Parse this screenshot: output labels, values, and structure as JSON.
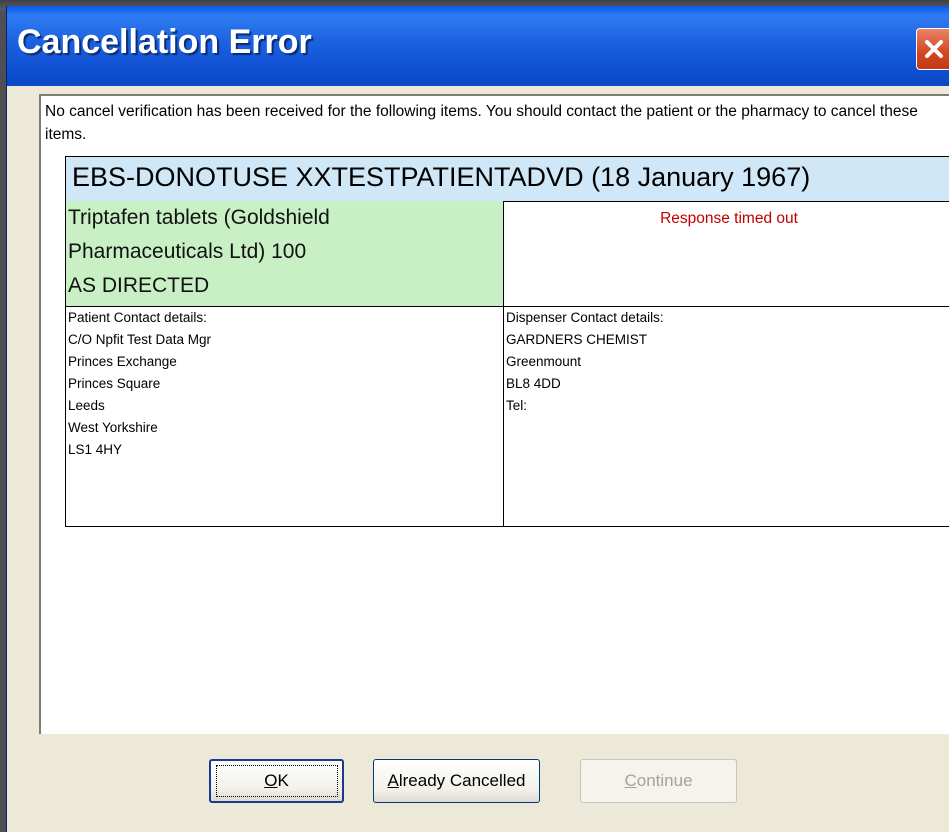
{
  "window": {
    "title": "Cancellation Error",
    "close_icon": "close-x-icon"
  },
  "message": "No cancel verification has been received for the following items. You should contact the patient or the pharmacy to cancel these items.",
  "patient": {
    "header": "EBS-DONOTUSE XXTESTPATIENTADVD (18 January 1967)"
  },
  "item": {
    "drug_lines": [
      "Triptafen tablets (Goldshield",
      "Pharmaceuticals Ltd) 100",
      "AS DIRECTED"
    ],
    "status": "Response timed out"
  },
  "patient_contact": {
    "lines": [
      "Patient Contact details:",
      "C/O Npfit Test Data Mgr",
      "Princes Exchange",
      "Princes Square",
      "Leeds",
      "West Yorkshire",
      "LS1 4HY"
    ]
  },
  "dispenser_contact": {
    "lines": [
      "Dispenser Contact details:",
      "GARDNERS CHEMIST",
      "Greenmount",
      "BL8 4DD",
      "Tel:"
    ]
  },
  "buttons": {
    "ok_mnemonic": "O",
    "ok_rest": "K",
    "cancelled_mnemonic": "A",
    "cancelled_rest": "lready Cancelled",
    "continue_mnemonic": "C",
    "continue_rest": "ontinue"
  },
  "colors": {
    "title_bar": "#1c62e0",
    "patient_header_bg": "#cfe7f7",
    "drug_cell_bg": "#c8f0c4",
    "status_text": "#c00000"
  }
}
